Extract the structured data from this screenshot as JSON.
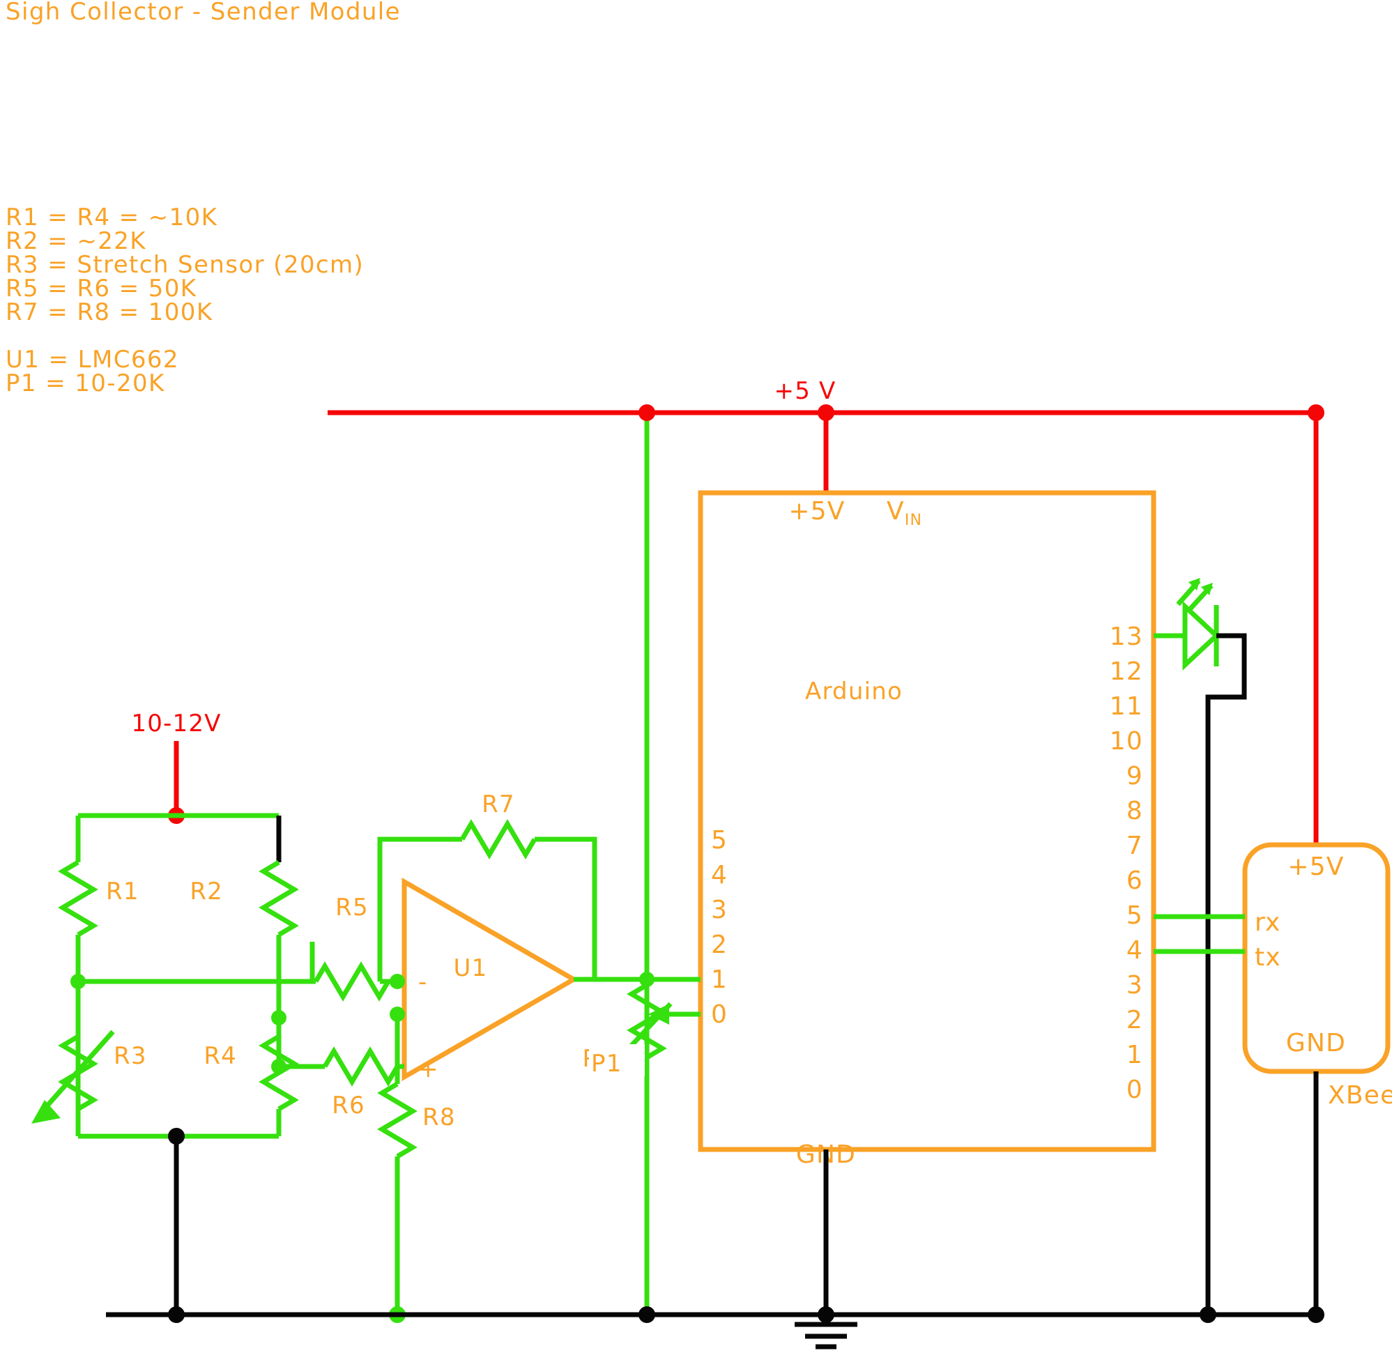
{
  "title": "Sigh Collector - Sender Module",
  "colors": {
    "accent_orange": "#f9a227",
    "wire_green": "#35e00e",
    "wire_red": "#f50606",
    "wire_black": "#060606",
    "background": "#ffffff"
  },
  "legend": {
    "lines": [
      "R1 = R4 = ~10K",
      "R2 = ~22K",
      "R3 = Stretch Sensor (20cm)",
      "R5 = R6 = 50K",
      "R7 = R8 = 100K"
    ],
    "lines2": [
      "U1 = LMC662",
      "P1 = 10-20K"
    ]
  },
  "supplies": {
    "rail_5v": "+5 V",
    "bridge_supply": "10-12V"
  },
  "arduino": {
    "name": "Arduino",
    "pin_5v": "+5V",
    "pin_vin": "V",
    "pin_vin_sub": "IN",
    "pin_gnd": "GND",
    "analog_pins": [
      "5",
      "4",
      "3",
      "2",
      "1",
      "0"
    ],
    "digital_pins": [
      "13",
      "12",
      "11",
      "10",
      "9",
      "8",
      "7",
      "6",
      "5",
      "4",
      "3",
      "2",
      "1",
      "0"
    ]
  },
  "xbee": {
    "name": "XBee",
    "pin_5v": "+5V",
    "pin_rx": "rx",
    "pin_tx": "tx",
    "pin_gnd": "GND"
  },
  "components": {
    "r1": "R1",
    "r2": "R2",
    "r3": "R3",
    "r4": "R4",
    "r5": "R5",
    "r6": "R6",
    "r7": "R7",
    "r8": "R8",
    "u1": "U1",
    "p1": "P1",
    "opamp_minus": "-",
    "opamp_plus": "+"
  }
}
